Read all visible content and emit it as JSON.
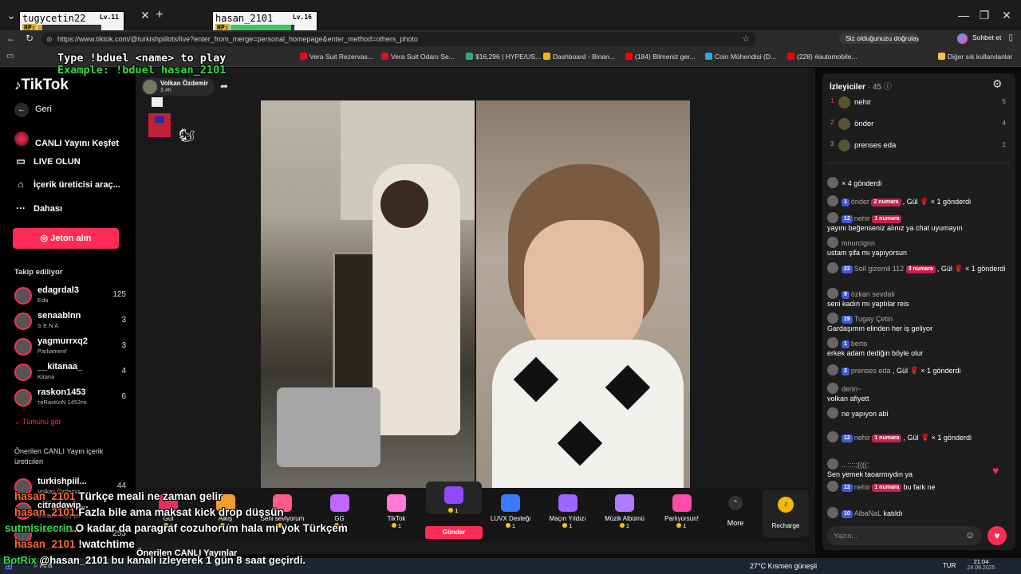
{
  "overlay": {
    "players": [
      {
        "name": "tugycetin22",
        "level": "Lv.11",
        "hp": "HP:",
        "bar_color": "#d6a322",
        "hp_fraction": 0.08
      },
      {
        "name": "hasan_2101",
        "level": "Lv.16",
        "hp": "HP:",
        "bar_color": "#3fc55a",
        "hp_fraction": 0.95
      }
    ],
    "line1": "Type !bduel <name> to play",
    "line2": "Example: !bduel hasan_2101",
    "bottom_lines": [
      {
        "user": "hasan_2101",
        "text": "Türkçe meali ne zaman gelir"
      },
      {
        "user": "hasan_2101",
        "text": "Fazla bile ama maksat kick drop düşsün"
      },
      {
        "user": "sutmisirecrin",
        "text": "O kadar da paragraf cozuhorum hala mi yok Türkçem"
      },
      {
        "user": "hasan_2101",
        "text": "!watchtime"
      }
    ],
    "bot_line": {
      "user": "BotRix",
      "text": "@hasan_2101 bu kanalı izleyerek 1 gün 8 saat geçirdi."
    }
  },
  "browser": {
    "url": "https://www.tiktok.com/@turkishpiilots/live?enter_from_merge=personal_homepage&enter_method=others_photo",
    "verify_label": "Siz olduğunuzu doğrulayın",
    "chat_label": "Sohbet et",
    "other_bookmarks": "Diğer sık kullanılanlar",
    "bookmarks": [
      {
        "label": "Vera Suit Rezervas...",
        "color": "#d12"
      },
      {
        "label": "Vera Suit Odanı Se...",
        "color": "#d12"
      },
      {
        "label": "$16,296 | HYPE/US...",
        "color": "#3a7"
      },
      {
        "label": "Dashboard - Binan...",
        "color": "#f0b90b"
      },
      {
        "label": "(184) Bilmeniz ger...",
        "color": "#f00"
      },
      {
        "label": "Coin Mühendisi (D...",
        "color": "#29a9eb"
      },
      {
        "label": "(228) #automobile...",
        "color": "#f00"
      }
    ]
  },
  "sidebar": {
    "logo": "TikTok",
    "back": "Geri",
    "explore_live": "CANLI Yayını Keşfet",
    "go_live": "LIVE OLUN",
    "creator_tools": "İçerik üreticisi araç...",
    "more": "Dahası",
    "coins_button": "Jeton alın",
    "following_title": "Takip ediliyor",
    "following": [
      {
        "name": "edagrdal3",
        "sub": "Eda",
        "count": "125"
      },
      {
        "name": "senaablnn",
        "sub": "S E N A",
        "count": "3"
      },
      {
        "name": "yagmurrxq2",
        "sub": "Parliament'",
        "count": "3"
      },
      {
        "name": "__kitanaa_",
        "sub": "Kitana",
        "count": "4"
      },
      {
        "name": "raskon1453",
        "sub": "ᴛʀRasKoN 1453ᴛʀ",
        "count": "6"
      }
    ],
    "see_all": "Tümünü gör",
    "recommended_title": "Önerilen CANLI Yayın içerik üreticileri",
    "recommended": [
      {
        "name": "turkishpiil...",
        "sub": "Volkan Özdemir",
        "count": "44"
      },
      {
        "name": "citradawip...",
        "sub": "Citradewiady ps",
        "count": ""
      },
      {
        "name": "berfinec...",
        "sub": "",
        "count": "253"
      }
    ]
  },
  "stream": {
    "host": "Volkan Özdemir",
    "likes": "3.4K",
    "recommended_lives": "Önerilen CANLI Yayınlar"
  },
  "gifts": [
    {
      "name": "Gül",
      "cost": "1",
      "color": "#e3325a"
    },
    {
      "name": "Alkış",
      "cost": "1",
      "color": "#f0a030"
    },
    {
      "name": "Seni seviyorum",
      "cost": "1",
      "color": "#ff5a88"
    },
    {
      "name": "GG",
      "cost": "1",
      "color": "#c266ff"
    },
    {
      "name": "TikTok",
      "cost": "1",
      "color": "#ff7ad9"
    },
    {
      "name": "Gönder",
      "cost": "1",
      "color": "#8f4aff"
    },
    {
      "name": "LUVX Desteği",
      "cost": "1",
      "color": "#3a7bff"
    },
    {
      "name": "Maçın Yıldızı",
      "cost": "1",
      "color": "#9c66ff"
    },
    {
      "name": "Müzik Albümü",
      "cost": "1",
      "color": "#b07cff"
    },
    {
      "name": "Parlıyorsun!",
      "cost": "1",
      "color": "#ff4aa8"
    }
  ],
  "gift_more": "More",
  "recharge": "Recharge",
  "chat": {
    "title": "İzleyiciler",
    "count": "· 45",
    "top": [
      {
        "rank": "1",
        "name": "nehir",
        "score": "5"
      },
      {
        "rank": "2",
        "name": "önder",
        "score": "4"
      },
      {
        "rank": "3",
        "name": "prenses eda",
        "score": "1"
      }
    ],
    "messages": [
      {
        "user": "",
        "lv": "",
        "num": "",
        "text": "× 4 gönderdi"
      },
      {
        "user": "önder",
        "lv": "1",
        "num": "2 numara",
        "text": ", Gül 🌹 × 1 gönderdi"
      },
      {
        "user": "nehir",
        "lv": "12",
        "num": "1 numara",
        "text": "yayını beğenseniz alınız ya chat uyumayın"
      },
      {
        "user": "mnurclgnn",
        "lv": "",
        "num": "",
        "text": "ustam şifa mı yapıyorsun"
      },
      {
        "user": "Soil gizemli 112",
        "lv": "22",
        "num": "3 numara",
        "text": ", Gül 🌹 × 1 gönderdi"
      },
      {
        "user": "özkan sevdalı",
        "lv": "9",
        "num": "",
        "text": "seni kadın mı yaptılar reis"
      },
      {
        "user": "Tugay Çetin",
        "lv": "19",
        "num": "",
        "text": "Gardaşımın elinden her iş geliyor"
      },
      {
        "user": "berto",
        "lv": "1",
        "num": "",
        "text": "erkek adam dediğin böyle olur"
      },
      {
        "user": "prenses eda",
        "lv": "2",
        "num": "",
        "text": ", Gül 🌹 × 1 gönderdi"
      },
      {
        "user": "derin~",
        "lv": "",
        "num": "",
        "text": "volkan afiyett"
      },
      {
        "user": "",
        "lv": "",
        "num": "",
        "text": "ne yapıyon abi"
      },
      {
        "user": "nehir",
        "lv": "12",
        "num": "1 numara",
        "text": ", Gül 🌹 × 1 gönderdi"
      },
      {
        "user": "...::::;((((:",
        "lv": "",
        "num": "",
        "text": "Sen yemek taoarmıydın ya"
      },
      {
        "user": "nehir",
        "lv": "12",
        "num": "1 numara",
        "text": "bu fark ne"
      },
      {
        "user": "AlbaNaL",
        "lv": "10",
        "num": "",
        "text": "katıldı"
      }
    ],
    "input_placeholder": "Yazın..."
  },
  "taskbar": {
    "search": "Ara",
    "weather": "27°C  Kısmen güneşli",
    "lang": "TUR",
    "time": "21:04",
    "date": "24.08.2025"
  }
}
